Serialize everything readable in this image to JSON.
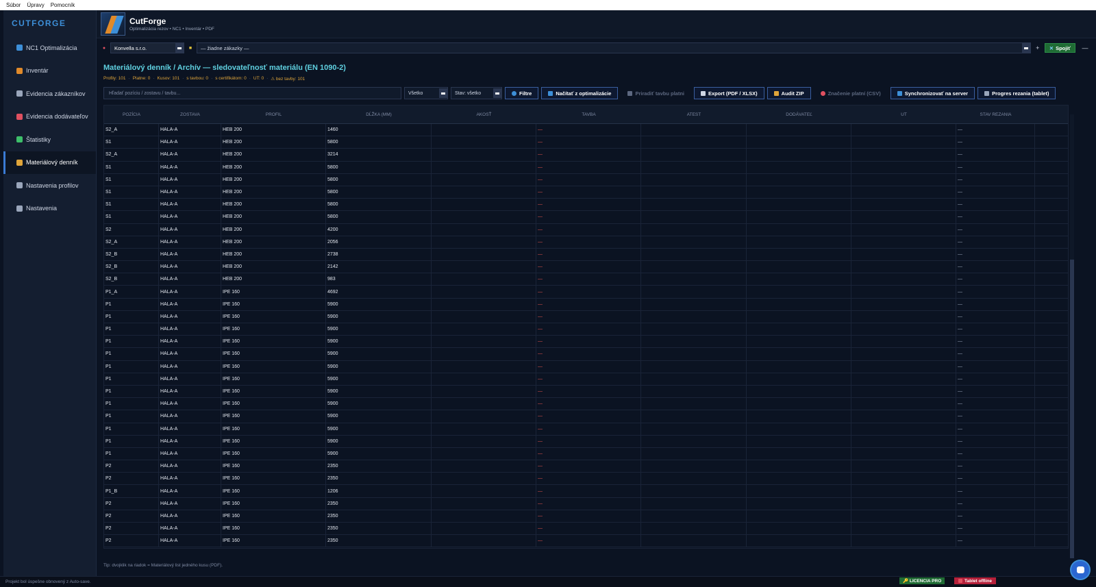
{
  "menubar": {
    "items": [
      "Súbor",
      "Úpravy",
      "Pomocník"
    ]
  },
  "sidebar": {
    "brand": "CUTFORGE",
    "items": [
      {
        "label": "NC1 Optimalizácia",
        "icon": "nc1-icon",
        "color": "#3d8fd8"
      },
      {
        "label": "Inventár",
        "icon": "inventory-icon",
        "color": "#e08a2a"
      },
      {
        "label": "Evidencia zákazníkov",
        "icon": "customers-icon",
        "color": "#9aa6bb"
      },
      {
        "label": "Evidencia dodávateľov",
        "icon": "suppliers-icon",
        "color": "#e05060"
      },
      {
        "label": "Štatistiky",
        "icon": "stats-icon",
        "color": "#3dbf6a"
      },
      {
        "label": "Materiálový denník",
        "icon": "journal-icon",
        "color": "#e0a53a"
      },
      {
        "label": "Nastavenia profilov",
        "icon": "wrench-icon",
        "color": "#9aa6bb"
      },
      {
        "label": "Nastavenia",
        "icon": "gear-icon",
        "color": "#9aa6bb"
      }
    ],
    "active_index": 5
  },
  "header": {
    "app_name": "CutForge",
    "subtitle": "Optimalizácia rezov • NC1 • Inventár • PDF"
  },
  "context": {
    "customer": "Konvella s.r.o.",
    "order": "— žiadne zákazky —",
    "plus": "+",
    "connect_label": "Spojiť",
    "minus": "—"
  },
  "page": {
    "title": "Materiálový denník / Archív — sledovateľnosť materiálu (EN 1090-2)",
    "stats": [
      "Profily: 101",
      "Platne: 0",
      "Kusov: 101",
      "s tavbou: 0",
      "s certifikátom: 0",
      "UT: 0",
      "⚠ bez tavby: 101"
    ],
    "search_placeholder": "Hľadať pozíciu / zostavu / tavbu...",
    "filter_all": "Všetko",
    "filter_state": "Stav: všetko",
    "buttons": {
      "filters": "Filtre",
      "load": "Načítať z optimalizácie",
      "assign": "Priradiť tavbu platni",
      "export": "Export (PDF / XLSX)",
      "audit": "Audit ZIP",
      "marking": "Značenie platní (CSV)",
      "sync": "Synchronizovať na server",
      "progress": "Progres rezania (tablet)"
    },
    "tip": "Tip: dvojklik na riadok = Materiálový list jedného kusu (PDF)."
  },
  "table": {
    "columns": [
      "POZÍCIA",
      "ZOSTAVA",
      "PROFIL",
      "DĹŽKA (MM)",
      "AKOSŤ",
      "TAVBA",
      "ATEST",
      "DODÁVATEĽ",
      "UT",
      "STAV REZANIA"
    ],
    "rows": [
      [
        "S2_A",
        "HALA-A",
        "HEB 200",
        "1460"
      ],
      [
        "S1",
        "HALA-A",
        "HEB 200",
        "5800"
      ],
      [
        "S2_A",
        "HALA-A",
        "HEB 200",
        "3214"
      ],
      [
        "S1",
        "HALA-A",
        "HEB 200",
        "5800"
      ],
      [
        "S1",
        "HALA-A",
        "HEB 200",
        "5800"
      ],
      [
        "S1",
        "HALA-A",
        "HEB 200",
        "5800"
      ],
      [
        "S1",
        "HALA-A",
        "HEB 200",
        "5800"
      ],
      [
        "S1",
        "HALA-A",
        "HEB 200",
        "5800"
      ],
      [
        "S2",
        "HALA-A",
        "HEB 200",
        "4200"
      ],
      [
        "S2_A",
        "HALA-A",
        "HEB 200",
        "2056"
      ],
      [
        "S2_B",
        "HALA-A",
        "HEB 200",
        "2738"
      ],
      [
        "S2_B",
        "HALA-A",
        "HEB 200",
        "2142"
      ],
      [
        "S2_B",
        "HALA-A",
        "HEB 200",
        "983"
      ],
      [
        "P1_A",
        "HALA-A",
        "IPE 160",
        "4692"
      ],
      [
        "P1",
        "HALA-A",
        "IPE 160",
        "5900"
      ],
      [
        "P1",
        "HALA-A",
        "IPE 160",
        "5900"
      ],
      [
        "P1",
        "HALA-A",
        "IPE 160",
        "5900"
      ],
      [
        "P1",
        "HALA-A",
        "IPE 160",
        "5900"
      ],
      [
        "P1",
        "HALA-A",
        "IPE 160",
        "5900"
      ],
      [
        "P1",
        "HALA-A",
        "IPE 160",
        "5900"
      ],
      [
        "P1",
        "HALA-A",
        "IPE 160",
        "5900"
      ],
      [
        "P1",
        "HALA-A",
        "IPE 160",
        "5900"
      ],
      [
        "P1",
        "HALA-A",
        "IPE 160",
        "5900"
      ],
      [
        "P1",
        "HALA-A",
        "IPE 160",
        "5900"
      ],
      [
        "P1",
        "HALA-A",
        "IPE 160",
        "5900"
      ],
      [
        "P1",
        "HALA-A",
        "IPE 160",
        "5900"
      ],
      [
        "P1",
        "HALA-A",
        "IPE 160",
        "5900"
      ],
      [
        "P2",
        "HALA-A",
        "IPE 160",
        "2350"
      ],
      [
        "P2",
        "HALA-A",
        "IPE 160",
        "2350"
      ],
      [
        "P1_B",
        "HALA-A",
        "IPE 160",
        "1206"
      ],
      [
        "P2",
        "HALA-A",
        "IPE 160",
        "2350"
      ],
      [
        "P2",
        "HALA-A",
        "IPE 160",
        "2350"
      ],
      [
        "P2",
        "HALA-A",
        "IPE 160",
        "2350"
      ],
      [
        "P2",
        "HALA-A",
        "IPE 160",
        "2350"
      ]
    ],
    "tavba_empty": "—",
    "stav_empty": "—"
  },
  "status": {
    "message": "Projekt bol úspešne obnovený z Auto-save.",
    "license": "🔑 LICENCIA PRO",
    "tablet": "Tablet offline"
  },
  "colors": {
    "accent": "#5fd0e0",
    "warning": "#e0a53a",
    "danger": "#e0504a",
    "success": "#1f6b34"
  }
}
